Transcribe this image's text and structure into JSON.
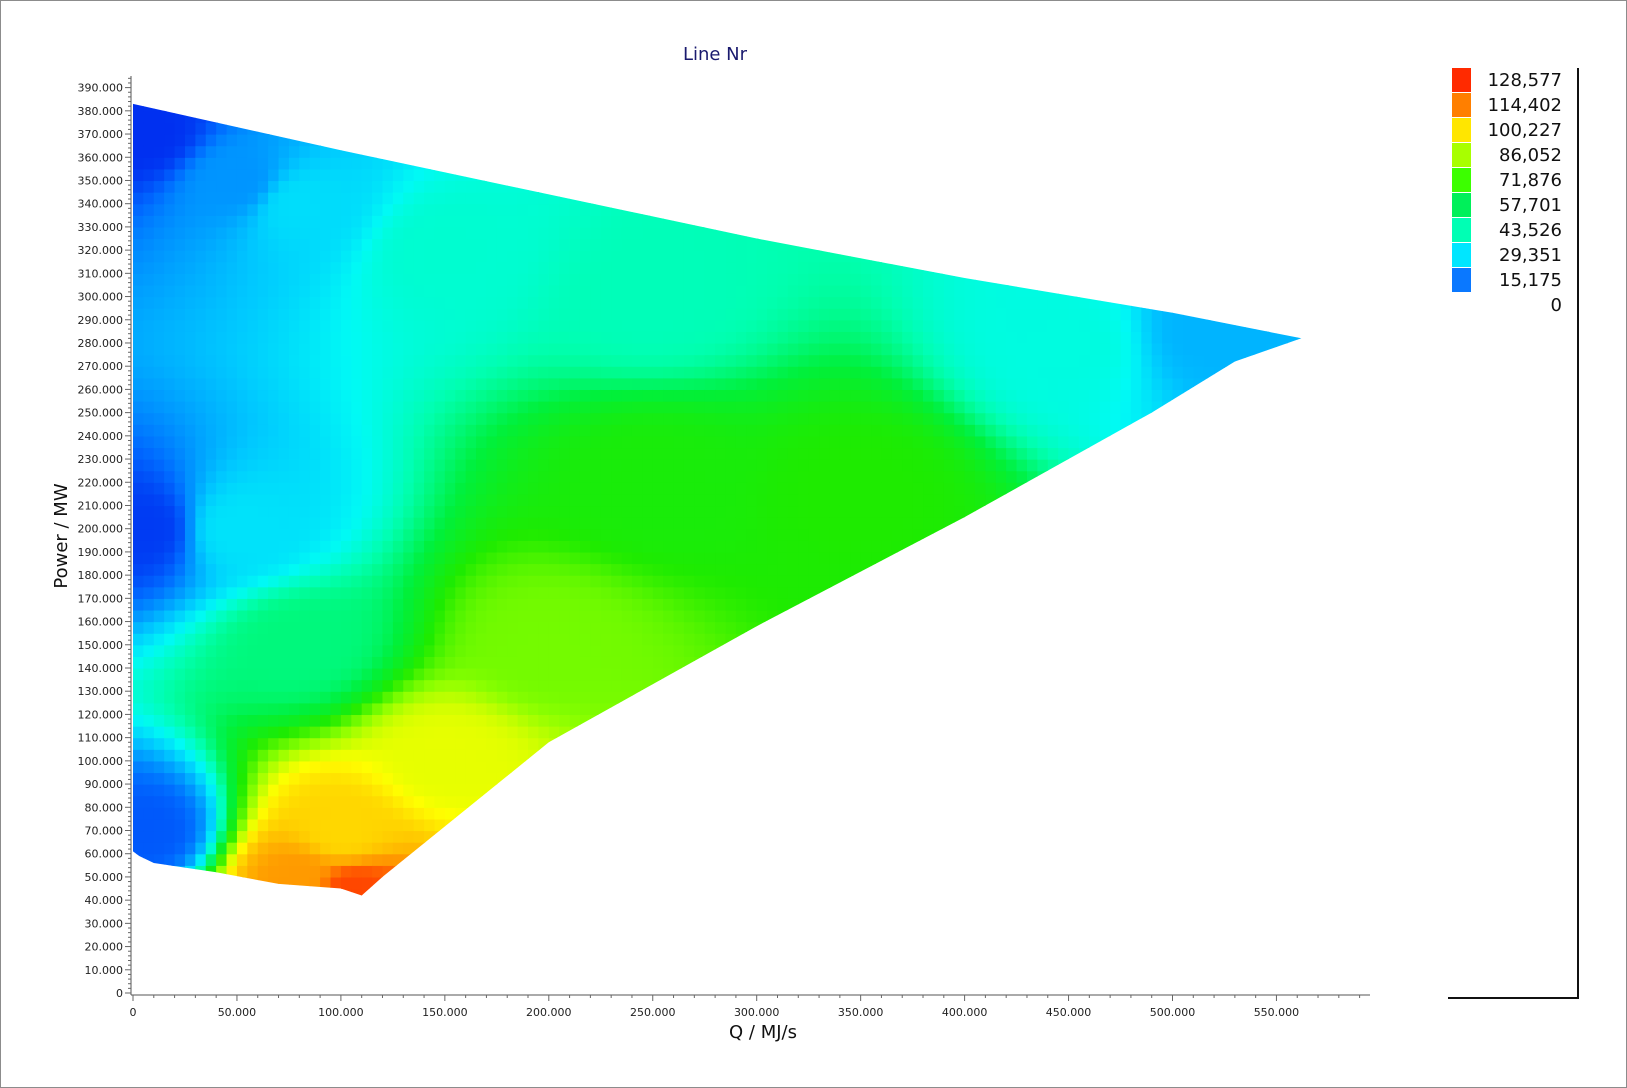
{
  "chart_data": {
    "type": "heatmap",
    "title": "Line Nr",
    "xlabel": "Q / MJ/s",
    "ylabel": "Power / MW",
    "xlim": [
      0,
      595000
    ],
    "ylim": [
      0,
      395000
    ],
    "x_ticks": [
      {
        "value": 0,
        "label": "0"
      },
      {
        "value": 50000,
        "label": "50.000"
      },
      {
        "value": 100000,
        "label": "100.000"
      },
      {
        "value": 150000,
        "label": "150.000"
      },
      {
        "value": 200000,
        "label": "200.000"
      },
      {
        "value": 250000,
        "label": "250.000"
      },
      {
        "value": 300000,
        "label": "300.000"
      },
      {
        "value": 350000,
        "label": "350.000"
      },
      {
        "value": 400000,
        "label": "400.000"
      },
      {
        "value": 450000,
        "label": "450.000"
      },
      {
        "value": 500000,
        "label": "500.000"
      },
      {
        "value": 550000,
        "label": "550.000"
      }
    ],
    "y_ticks": [
      {
        "value": 0,
        "label": "0"
      },
      {
        "value": 10000,
        "label": "10.000"
      },
      {
        "value": 20000,
        "label": "20.000"
      },
      {
        "value": 30000,
        "label": "30.000"
      },
      {
        "value": 40000,
        "label": "40.000"
      },
      {
        "value": 50000,
        "label": "50.000"
      },
      {
        "value": 60000,
        "label": "60.000"
      },
      {
        "value": 70000,
        "label": "70.000"
      },
      {
        "value": 80000,
        "label": "80.000"
      },
      {
        "value": 90000,
        "label": "90.000"
      },
      {
        "value": 100000,
        "label": "100.000"
      },
      {
        "value": 110000,
        "label": "110.000"
      },
      {
        "value": 120000,
        "label": "120.000"
      },
      {
        "value": 130000,
        "label": "130.000"
      },
      {
        "value": 140000,
        "label": "140.000"
      },
      {
        "value": 150000,
        "label": "150.000"
      },
      {
        "value": 160000,
        "label": "160.000"
      },
      {
        "value": 170000,
        "label": "170.000"
      },
      {
        "value": 180000,
        "label": "180.000"
      },
      {
        "value": 190000,
        "label": "190.000"
      },
      {
        "value": 200000,
        "label": "200.000"
      },
      {
        "value": 210000,
        "label": "210.000"
      },
      {
        "value": 220000,
        "label": "220.000"
      },
      {
        "value": 230000,
        "label": "230.000"
      },
      {
        "value": 240000,
        "label": "240.000"
      },
      {
        "value": 250000,
        "label": "250.000"
      },
      {
        "value": 260000,
        "label": "260.000"
      },
      {
        "value": 270000,
        "label": "270.000"
      },
      {
        "value": 280000,
        "label": "280.000"
      },
      {
        "value": 290000,
        "label": "290.000"
      },
      {
        "value": 300000,
        "label": "300.000"
      },
      {
        "value": 310000,
        "label": "310.000"
      },
      {
        "value": 320000,
        "label": "320.000"
      },
      {
        "value": 330000,
        "label": "330.000"
      },
      {
        "value": 340000,
        "label": "340.000"
      },
      {
        "value": 350000,
        "label": "350.000"
      },
      {
        "value": 360000,
        "label": "360.000"
      },
      {
        "value": 370000,
        "label": "370.000"
      },
      {
        "value": 380000,
        "label": "380.000"
      },
      {
        "value": 390000,
        "label": "390.000"
      }
    ],
    "region_boundary": [
      {
        "q": 0,
        "p": 383000
      },
      {
        "q": 100000,
        "p": 363000
      },
      {
        "q": 200000,
        "p": 344000
      },
      {
        "q": 300000,
        "p": 325000
      },
      {
        "q": 400000,
        "p": 308000
      },
      {
        "q": 500000,
        "p": 293000
      },
      {
        "q": 562000,
        "p": 282000
      },
      {
        "q": 530000,
        "p": 272000
      },
      {
        "q": 490000,
        "p": 250000
      },
      {
        "q": 400000,
        "p": 205000
      },
      {
        "q": 300000,
        "p": 158000
      },
      {
        "q": 200000,
        "p": 108000
      },
      {
        "q": 120000,
        "p": 50000
      },
      {
        "q": 110000,
        "p": 42000
      },
      {
        "q": 100000,
        "p": 45000
      },
      {
        "q": 70000,
        "p": 47000
      },
      {
        "q": 40000,
        "p": 52000
      },
      {
        "q": 25000,
        "p": 54000
      },
      {
        "q": 10000,
        "p": 56000
      },
      {
        "q": 3000,
        "p": 59000
      },
      {
        "q": 0,
        "p": 61000
      }
    ],
    "value_range": [
      0,
      128577
    ],
    "field_samples": [
      {
        "q": 5000,
        "p": 370000,
        "value": 3000
      },
      {
        "q": 5000,
        "p": 200000,
        "value": 5000
      },
      {
        "q": 5000,
        "p": 70000,
        "value": 10000
      },
      {
        "q": 50000,
        "p": 350000,
        "value": 20000
      },
      {
        "q": 50000,
        "p": 200000,
        "value": 33000
      },
      {
        "q": 80000,
        "p": 340000,
        "value": 32000
      },
      {
        "q": 80000,
        "p": 150000,
        "value": 52000
      },
      {
        "q": 150000,
        "p": 320000,
        "value": 42000
      },
      {
        "q": 250000,
        "p": 300000,
        "value": 45000
      },
      {
        "q": 250000,
        "p": 220000,
        "value": 70000
      },
      {
        "q": 350000,
        "p": 215000,
        "value": 72000
      },
      {
        "q": 450000,
        "p": 280000,
        "value": 40000
      },
      {
        "q": 520000,
        "p": 285000,
        "value": 25000
      },
      {
        "q": 200000,
        "p": 150000,
        "value": 82000
      },
      {
        "q": 150000,
        "p": 100000,
        "value": 95000
      },
      {
        "q": 100000,
        "p": 70000,
        "value": 105000
      },
      {
        "q": 80000,
        "p": 50000,
        "value": 115000
      },
      {
        "q": 105000,
        "p": 43000,
        "value": 125000
      }
    ],
    "colorbar": {
      "labels": [
        "128,577",
        "114,402",
        "100,227",
        "86,052",
        "71,876",
        "57,701",
        "43,526",
        "29,351",
        "15,175",
        "0"
      ],
      "colors": [
        "#ff2a00",
        "#ff7f00",
        "#ffe600",
        "#a8ff00",
        "#3cff00",
        "#00f05a",
        "#00ffb4",
        "#00e6ff",
        "#0a78ff"
      ]
    }
  }
}
